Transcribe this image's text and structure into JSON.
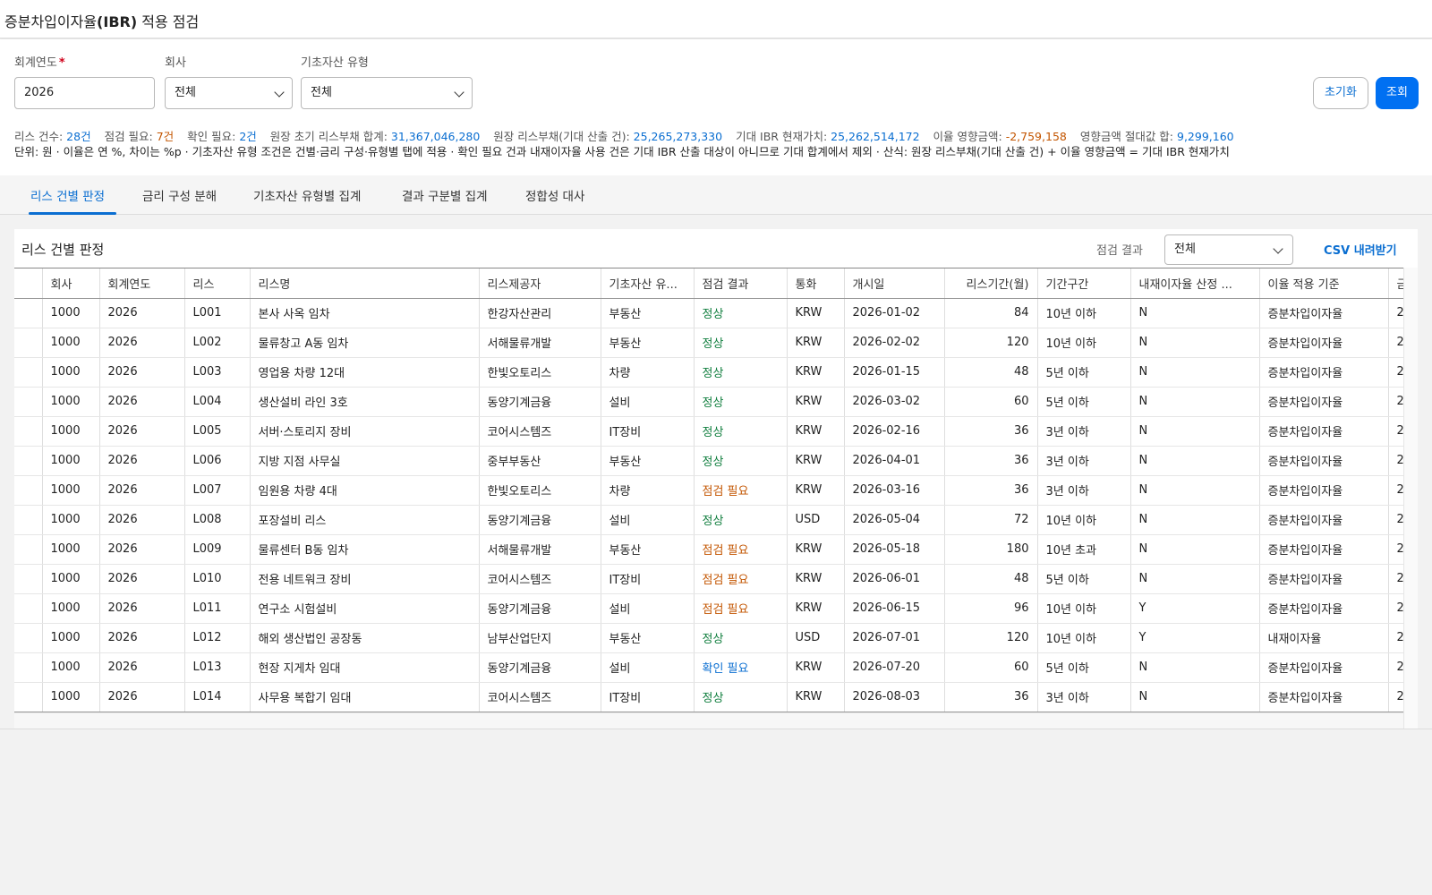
{
  "page": {
    "title_prefix": "증분차입이자율",
    "title_bold": "(IBR)",
    "title_suffix": " 적용 점검"
  },
  "filters": {
    "year_label": "회계연도",
    "year_required_mark": "*",
    "year_value": "2026",
    "company_label": "회사",
    "company_value": "전체",
    "asset_type_label": "기초자산 유형",
    "asset_type_value": "전체",
    "reset_label": "초기화",
    "search_label": "조회"
  },
  "summary": {
    "lease_count_label": "리스 건수:",
    "lease_count": "28건",
    "check_needed_label": "점검 필요:",
    "check_needed": "7건",
    "confirm_needed_label": "확인 필요:",
    "confirm_needed": "2건",
    "ledger_initial_label": "원장 초기 리스부채 합계:",
    "ledger_initial": "31,367,046,280",
    "ledger_expected_label": "원장 리스부채(기대 산출 건):",
    "ledger_expected": "25,265,273,330",
    "expected_pv_label": "기대 IBR 현재가치:",
    "expected_pv": "25,262,514,172",
    "rate_impact_label": "이율 영향금액:",
    "rate_impact": "-2,759,158",
    "abs_impact_label": "영향금액 절대값 합:",
    "abs_impact": "9,299,160",
    "note": "단위: 원 · 이율은 연 %, 차이는 %p · 기초자산 유형 조건은 건별·금리 구성·유형별 탭에 적용 · 확인 필요 건과 내재이자율 사용 건은 기대 IBR 산출 대상이 아니므로 기대 합계에서 제외 · 산식: 원장 리스부채(기대 산출 건) + 이율 영향금액 = 기대 IBR 현재가치"
  },
  "tabs": [
    {
      "label": "리스 건별 판정"
    },
    {
      "label": "금리 구성 분해"
    },
    {
      "label": "기초자산 유형별 집계"
    },
    {
      "label": "결과 구분별 집계"
    },
    {
      "label": "정합성 대사"
    }
  ],
  "panel": {
    "title": "리스 건별 판정",
    "result_filter_label": "점검 결과",
    "result_filter_value": "전체",
    "csv_label": "CSV 내려받기"
  },
  "table": {
    "headers": {
      "company": "회사",
      "year": "회계연도",
      "lease": "리스",
      "lease_name": "리스명",
      "lessor": "리스제공자",
      "asset_type": "기초자산 유...",
      "result": "점검 결과",
      "currency": "통화",
      "start": "개시일",
      "term": "리스기간(월)",
      "term_band": "기간구간",
      "implicit": "내재이자율 산정 ...",
      "rate_basis": "이율 적용 기준",
      "extra": "금"
    },
    "rows": [
      {
        "company": "1000",
        "year": "2026",
        "lease": "L001",
        "name": "본사 사옥 임차",
        "lessor": "한강자산관리",
        "asset": "부동산",
        "result": "정상",
        "status": "normal",
        "currency": "KRW",
        "start": "2026-01-02",
        "term": "84",
        "band": "10년 이하",
        "implicit": "N",
        "basis": "증분차입이자율",
        "extra": "2"
      },
      {
        "company": "1000",
        "year": "2026",
        "lease": "L002",
        "name": "물류창고 A동 임차",
        "lessor": "서해물류개발",
        "asset": "부동산",
        "result": "정상",
        "status": "normal",
        "currency": "KRW",
        "start": "2026-02-02",
        "term": "120",
        "band": "10년 이하",
        "implicit": "N",
        "basis": "증분차입이자율",
        "extra": "2"
      },
      {
        "company": "1000",
        "year": "2026",
        "lease": "L003",
        "name": "영업용 차량 12대",
        "lessor": "한빛오토리스",
        "asset": "차량",
        "result": "정상",
        "status": "normal",
        "currency": "KRW",
        "start": "2026-01-15",
        "term": "48",
        "band": "5년 이하",
        "implicit": "N",
        "basis": "증분차입이자율",
        "extra": "2"
      },
      {
        "company": "1000",
        "year": "2026",
        "lease": "L004",
        "name": "생산설비 라인 3호",
        "lessor": "동양기계금융",
        "asset": "설비",
        "result": "정상",
        "status": "normal",
        "currency": "KRW",
        "start": "2026-03-02",
        "term": "60",
        "band": "5년 이하",
        "implicit": "N",
        "basis": "증분차입이자율",
        "extra": "2"
      },
      {
        "company": "1000",
        "year": "2026",
        "lease": "L005",
        "name": "서버·스토리지 장비",
        "lessor": "코어시스템즈",
        "asset": "IT장비",
        "result": "정상",
        "status": "normal",
        "currency": "KRW",
        "start": "2026-02-16",
        "term": "36",
        "band": "3년 이하",
        "implicit": "N",
        "basis": "증분차입이자율",
        "extra": "2"
      },
      {
        "company": "1000",
        "year": "2026",
        "lease": "L006",
        "name": "지방 지점 사무실",
        "lessor": "중부부동산",
        "asset": "부동산",
        "result": "정상",
        "status": "normal",
        "currency": "KRW",
        "start": "2026-04-01",
        "term": "36",
        "band": "3년 이하",
        "implicit": "N",
        "basis": "증분차입이자율",
        "extra": "2"
      },
      {
        "company": "1000",
        "year": "2026",
        "lease": "L007",
        "name": "임원용 차량 4대",
        "lessor": "한빛오토리스",
        "asset": "차량",
        "result": "점검 필요",
        "status": "check",
        "currency": "KRW",
        "start": "2026-03-16",
        "term": "36",
        "band": "3년 이하",
        "implicit": "N",
        "basis": "증분차입이자율",
        "extra": "2"
      },
      {
        "company": "1000",
        "year": "2026",
        "lease": "L008",
        "name": "포장설비 리스",
        "lessor": "동양기계금융",
        "asset": "설비",
        "result": "정상",
        "status": "normal",
        "currency": "USD",
        "start": "2026-05-04",
        "term": "72",
        "band": "10년 이하",
        "implicit": "N",
        "basis": "증분차입이자율",
        "extra": "2"
      },
      {
        "company": "1000",
        "year": "2026",
        "lease": "L009",
        "name": "물류센터 B동 임차",
        "lessor": "서해물류개발",
        "asset": "부동산",
        "result": "점검 필요",
        "status": "check",
        "currency": "KRW",
        "start": "2026-05-18",
        "term": "180",
        "band": "10년 초과",
        "implicit": "N",
        "basis": "증분차입이자율",
        "extra": "2"
      },
      {
        "company": "1000",
        "year": "2026",
        "lease": "L010",
        "name": "전용 네트워크 장비",
        "lessor": "코어시스템즈",
        "asset": "IT장비",
        "result": "점검 필요",
        "status": "check",
        "currency": "KRW",
        "start": "2026-06-01",
        "term": "48",
        "band": "5년 이하",
        "implicit": "N",
        "basis": "증분차입이자율",
        "extra": "2"
      },
      {
        "company": "1000",
        "year": "2026",
        "lease": "L011",
        "name": "연구소 시험설비",
        "lessor": "동양기계금융",
        "asset": "설비",
        "result": "점검 필요",
        "status": "check",
        "currency": "KRW",
        "start": "2026-06-15",
        "term": "96",
        "band": "10년 이하",
        "implicit": "Y",
        "basis": "증분차입이자율",
        "extra": "2"
      },
      {
        "company": "1000",
        "year": "2026",
        "lease": "L012",
        "name": "해외 생산법인 공장동",
        "lessor": "남부산업단지",
        "asset": "부동산",
        "result": "정상",
        "status": "normal",
        "currency": "USD",
        "start": "2026-07-01",
        "term": "120",
        "band": "10년 이하",
        "implicit": "Y",
        "basis": "내재이자율",
        "extra": "2"
      },
      {
        "company": "1000",
        "year": "2026",
        "lease": "L013",
        "name": "현장 지게차 임대",
        "lessor": "동양기계금융",
        "asset": "설비",
        "result": "확인 필요",
        "status": "confirm",
        "currency": "KRW",
        "start": "2026-07-20",
        "term": "60",
        "band": "5년 이하",
        "implicit": "N",
        "basis": "증분차입이자율",
        "extra": "2"
      },
      {
        "company": "1000",
        "year": "2026",
        "lease": "L014",
        "name": "사무용 복합기 임대",
        "lessor": "코어시스템즈",
        "asset": "IT장비",
        "result": "정상",
        "status": "normal",
        "currency": "KRW",
        "start": "2026-08-03",
        "term": "36",
        "band": "3년 이하",
        "implicit": "N",
        "basis": "증분차입이자율",
        "extra": "2"
      }
    ]
  },
  "colors": {
    "accent": "#0a6ed1",
    "primary_button": "#0070f2",
    "status_normal": "#107e3e",
    "status_check": "#c35500",
    "status_confirm": "#0a6ed1"
  }
}
